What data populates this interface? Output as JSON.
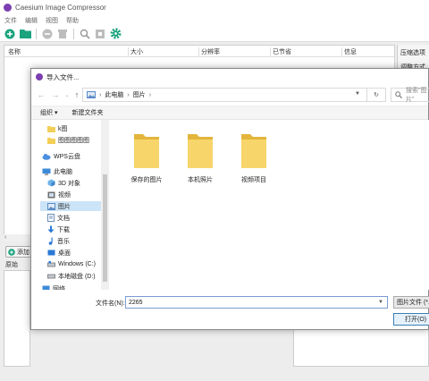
{
  "main": {
    "title": "Caesium Image Compressor",
    "menu": [
      "文件",
      "编辑",
      "视图",
      "帮助"
    ],
    "table_headers": [
      "名称",
      "大小",
      "分辨率",
      "已节省",
      "信息"
    ],
    "add_label": "添加",
    "original_label": "原始",
    "right_tabs": [
      "压缩选项",
      "调整方式"
    ]
  },
  "dialog": {
    "title": "导入文件...",
    "breadcrumb": [
      "此电脑",
      "图片"
    ],
    "search_placeholder": "搜索\"图片\"",
    "organize_label": "组织 ▾",
    "new_folder_label": "新建文件夹",
    "nav_items": [
      {
        "label": "k图",
        "icon": "folder-icon"
      },
      {
        "label": "图图图图图",
        "icon": "folder-icon"
      },
      {
        "label": "WPS云盘",
        "icon": "cloud-icon"
      },
      {
        "label": "此电脑",
        "icon": "computer-icon"
      },
      {
        "label": "3D 对象",
        "icon": "cube-icon"
      },
      {
        "label": "视频",
        "icon": "video-icon"
      },
      {
        "label": "图片",
        "icon": "picture-icon"
      },
      {
        "label": "文档",
        "icon": "document-icon"
      },
      {
        "label": "下载",
        "icon": "download-icon"
      },
      {
        "label": "音乐",
        "icon": "music-icon"
      },
      {
        "label": "桌面",
        "icon": "desktop-icon"
      },
      {
        "label": "Windows (C:)",
        "icon": "drive-icon"
      },
      {
        "label": "本地磁盘 (D:)",
        "icon": "drive-icon"
      },
      {
        "label": "网络",
        "icon": "network-icon"
      }
    ],
    "folders": [
      "保存的图片",
      "本机照片",
      "视频项目"
    ],
    "filename_label": "文件名(N):",
    "filename_value": "2265",
    "filter_label": "图片文件 (*.jpg",
    "open_label": "打开(O)"
  }
}
